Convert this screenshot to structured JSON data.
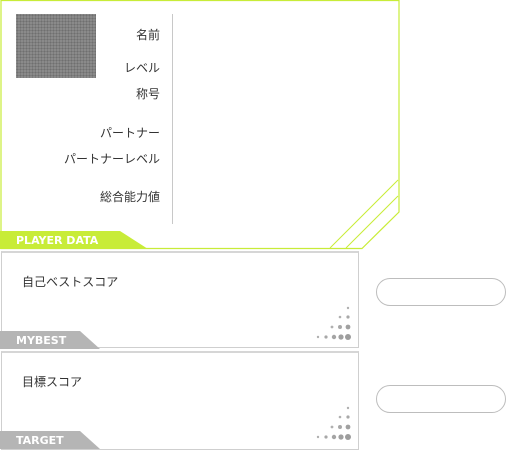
{
  "player_data": {
    "tab_label": "PLAYER DATA",
    "fields": {
      "name": "名前",
      "level": "レベル",
      "title": "称号",
      "partner": "パートナー",
      "partner_level": "パートナーレベル",
      "total_power": "総合能力値"
    }
  },
  "mybest": {
    "tab_label": "MYBEST",
    "title": "自己ベストスコア"
  },
  "target": {
    "tab_label": "TARGET",
    "title": "目標スコア"
  },
  "colors": {
    "accent": "#c8ec38",
    "tab_gray": "#b5b5b5",
    "border": "#cfcfcf"
  }
}
